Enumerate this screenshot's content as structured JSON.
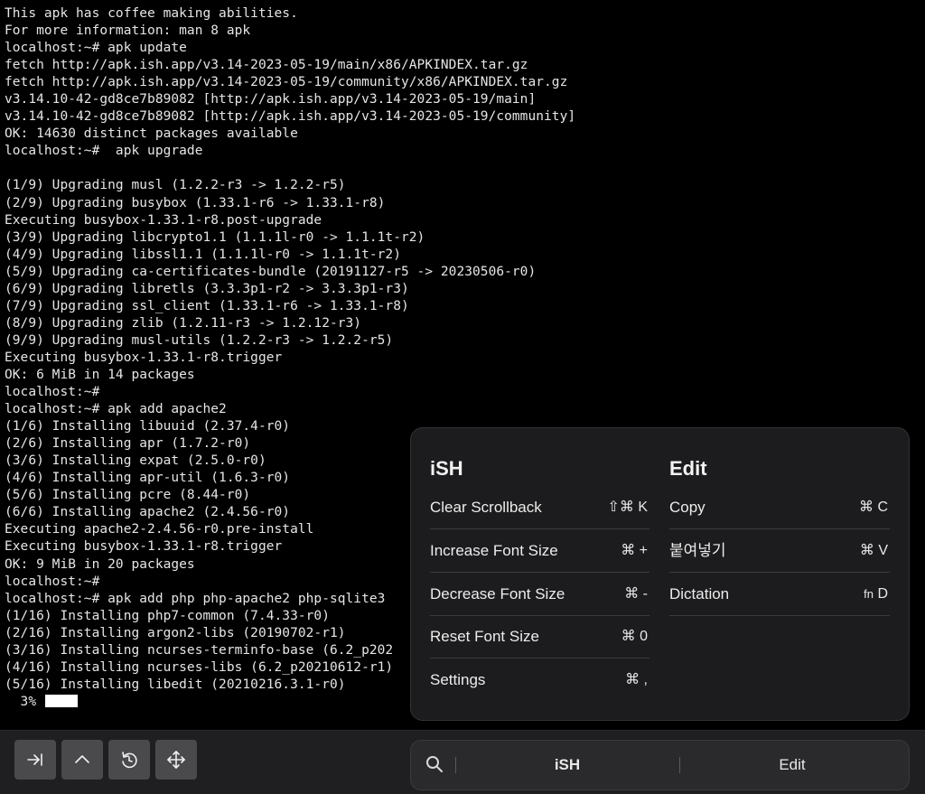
{
  "terminal": {
    "lines": [
      "This apk has coffee making abilities.",
      "For more information: man 8 apk",
      "localhost:~# apk update",
      "fetch http://apk.ish.app/v3.14-2023-05-19/main/x86/APKINDEX.tar.gz",
      "fetch http://apk.ish.app/v3.14-2023-05-19/community/x86/APKINDEX.tar.gz",
      "v3.14.10-42-gd8ce7b89082 [http://apk.ish.app/v3.14-2023-05-19/main]",
      "v3.14.10-42-gd8ce7b89082 [http://apk.ish.app/v3.14-2023-05-19/community]",
      "OK: 14630 distinct packages available",
      "localhost:~#  apk upgrade",
      "",
      "(1/9) Upgrading musl (1.2.2-r3 -> 1.2.2-r5)",
      "(2/9) Upgrading busybox (1.33.1-r6 -> 1.33.1-r8)",
      "Executing busybox-1.33.1-r8.post-upgrade",
      "(3/9) Upgrading libcrypto1.1 (1.1.1l-r0 -> 1.1.1t-r2)",
      "(4/9) Upgrading libssl1.1 (1.1.1l-r0 -> 1.1.1t-r2)",
      "(5/9) Upgrading ca-certificates-bundle (20191127-r5 -> 20230506-r0)",
      "(6/9) Upgrading libretls (3.3.3p1-r2 -> 3.3.3p1-r3)",
      "(7/9) Upgrading ssl_client (1.33.1-r6 -> 1.33.1-r8)",
      "(8/9) Upgrading zlib (1.2.11-r3 -> 1.2.12-r3)",
      "(9/9) Upgrading musl-utils (1.2.2-r3 -> 1.2.2-r5)",
      "Executing busybox-1.33.1-r8.trigger",
      "OK: 6 MiB in 14 packages",
      "localhost:~#",
      "localhost:~# apk add apache2",
      "(1/6) Installing libuuid (2.37.4-r0)",
      "(2/6) Installing apr (1.7.2-r0)",
      "(3/6) Installing expat (2.5.0-r0)",
      "(4/6) Installing apr-util (1.6.3-r0)",
      "(5/6) Installing pcre (8.44-r0)",
      "(6/6) Installing apache2 (2.4.56-r0)",
      "Executing apache2-2.4.56-r0.pre-install",
      "Executing busybox-1.33.1-r8.trigger",
      "OK: 9 MiB in 20 packages",
      "localhost:~#",
      "localhost:~# apk add php php-apache2 php-sqlite3",
      "(1/16) Installing php7-common (7.4.33-r0)",
      "(2/16) Installing argon2-libs (20190702-r1)",
      "(3/16) Installing ncurses-terminfo-base (6.2_p202",
      "(4/16) Installing ncurses-libs (6.2_p20210612-r1)",
      "(5/16) Installing libedit (20210216.3.1-r0)"
    ],
    "progress_text": "  3% ",
    "progress_fraction": 0.03
  },
  "popup": {
    "ish": {
      "title": "iSH",
      "items": [
        {
          "label": "Clear Scrollback",
          "shortcut": "⇧⌘ K"
        },
        {
          "label": "Increase Font Size",
          "shortcut": "⌘ +"
        },
        {
          "label": "Decrease Font Size",
          "shortcut": "⌘ -"
        },
        {
          "label": "Reset Font Size",
          "shortcut": "⌘ 0"
        },
        {
          "label": "Settings",
          "shortcut": "⌘ ,"
        }
      ]
    },
    "edit": {
      "title": "Edit",
      "items": [
        {
          "label": "Copy",
          "shortcut": "⌘ C"
        },
        {
          "label": "붙여넣기",
          "shortcut": "⌘ V"
        },
        {
          "label": "Dictation",
          "shortcut_fn": "fn",
          "shortcut": "D"
        }
      ]
    }
  },
  "toolbar": {
    "buttons": [
      {
        "name": "tab-key-button",
        "icon": "tab-arrow-icon"
      },
      {
        "name": "control-key-button",
        "icon": "caret-up-icon"
      },
      {
        "name": "escape-key-button",
        "icon": "rotate-icon"
      },
      {
        "name": "arrow-keys-button",
        "icon": "move-arrows-icon"
      }
    ],
    "menu_bar": {
      "ish_label": "iSH",
      "edit_label": "Edit"
    }
  },
  "colors": {
    "background": "#000000",
    "toolbar_bg": "#1f1f21",
    "key_button_bg": "#4a4a4c",
    "popup_bg": "#1c1c1e",
    "text": "#e8e8e8"
  }
}
